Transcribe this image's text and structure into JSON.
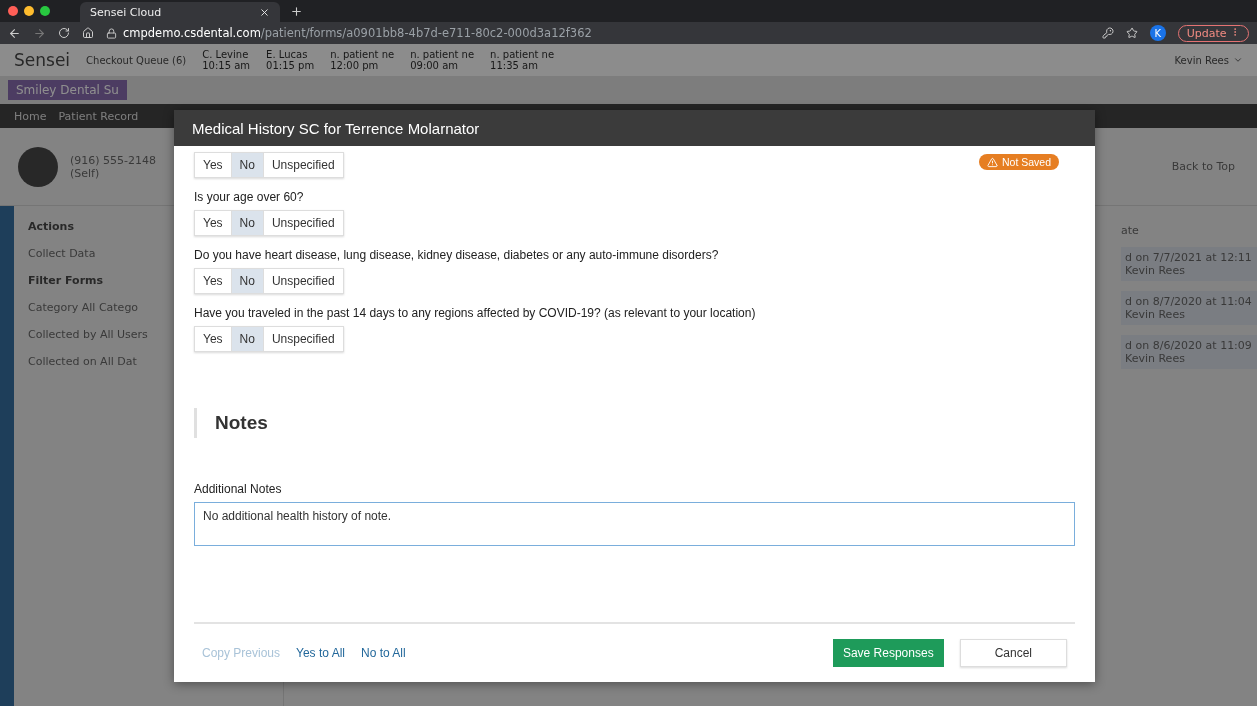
{
  "browser": {
    "tab_title": "Sensei Cloud",
    "url_host": "cmpdemo.csdental.com",
    "url_path": "/patient/forms/a0901bb8-4b7d-e711-80c2-000d3a12f362",
    "profile": "K",
    "update": "Update"
  },
  "app": {
    "logo": "Sensei",
    "queue": "Checkout Queue (6)",
    "appointments": [
      {
        "name": "C. Levine",
        "time": "10:15 am"
      },
      {
        "name": "E. Lucas",
        "time": "01:15 pm"
      },
      {
        "name": "n. patient ne",
        "time": "12:00 pm"
      },
      {
        "name": "n. patient ne",
        "time": "09:00 am"
      },
      {
        "name": "n. patient ne",
        "time": "11:35 am"
      }
    ],
    "user": "Kevin Rees",
    "practice": "Smiley Dental Su",
    "nav": [
      "Home",
      "Patient Record"
    ],
    "patient": {
      "phone": "(916) 555-2148",
      "relation": "(Self)"
    },
    "back_to_top": "Back to Top",
    "sidebar": {
      "actions_title": "Actions",
      "action": "Collect Data",
      "filter_title": "Filter Forms",
      "filters": [
        {
          "label": "Category",
          "value": "All Catego"
        },
        {
          "label": "Collected by",
          "value": "All Users"
        },
        {
          "label": "Collected on",
          "value": "All Dat"
        }
      ]
    },
    "history": {
      "heading": "ate",
      "entries": [
        {
          "text": "d on 7/7/2021 at 12:11",
          "by": "Kevin Rees"
        },
        {
          "text": "d on 8/7/2020 at 11:04",
          "by": "Kevin Rees"
        },
        {
          "text": "d on 8/6/2020 at 11:09",
          "by": "Kevin Rees"
        }
      ]
    }
  },
  "modal": {
    "title": "Medical History SC for Terrence Molarnator",
    "badge": "Not Saved",
    "questions": [
      {
        "options": [
          {
            "label": "Yes",
            "selected": false
          },
          {
            "label": "No",
            "selected": true
          },
          {
            "label": "Unspecified",
            "selected": false
          }
        ]
      },
      {
        "text": "Is your age over 60?",
        "options": [
          {
            "label": "Yes",
            "selected": false
          },
          {
            "label": "No",
            "selected": true
          },
          {
            "label": "Unspecified",
            "selected": false
          }
        ]
      },
      {
        "text": "Do you have heart disease, lung disease, kidney disease, diabetes or any auto-immune disorders?",
        "options": [
          {
            "label": "Yes",
            "selected": false
          },
          {
            "label": "No",
            "selected": true
          },
          {
            "label": "Unspecified",
            "selected": false
          }
        ]
      },
      {
        "text": "Have you traveled in the past 14 days to any regions affected by COVID-19? (as relevant to your location)",
        "options": [
          {
            "label": "Yes",
            "selected": false
          },
          {
            "label": "No",
            "selected": true
          },
          {
            "label": "Unspecified",
            "selected": false
          }
        ]
      }
    ],
    "notes_heading": "Notes",
    "notes_label": "Additional Notes",
    "notes_value": "No additional health history of note.",
    "links": [
      {
        "label": "Copy Previous",
        "disabled": true
      },
      {
        "label": "Yes to All",
        "disabled": false
      },
      {
        "label": "No to All",
        "disabled": false
      }
    ],
    "save": "Save Responses",
    "cancel": "Cancel"
  }
}
